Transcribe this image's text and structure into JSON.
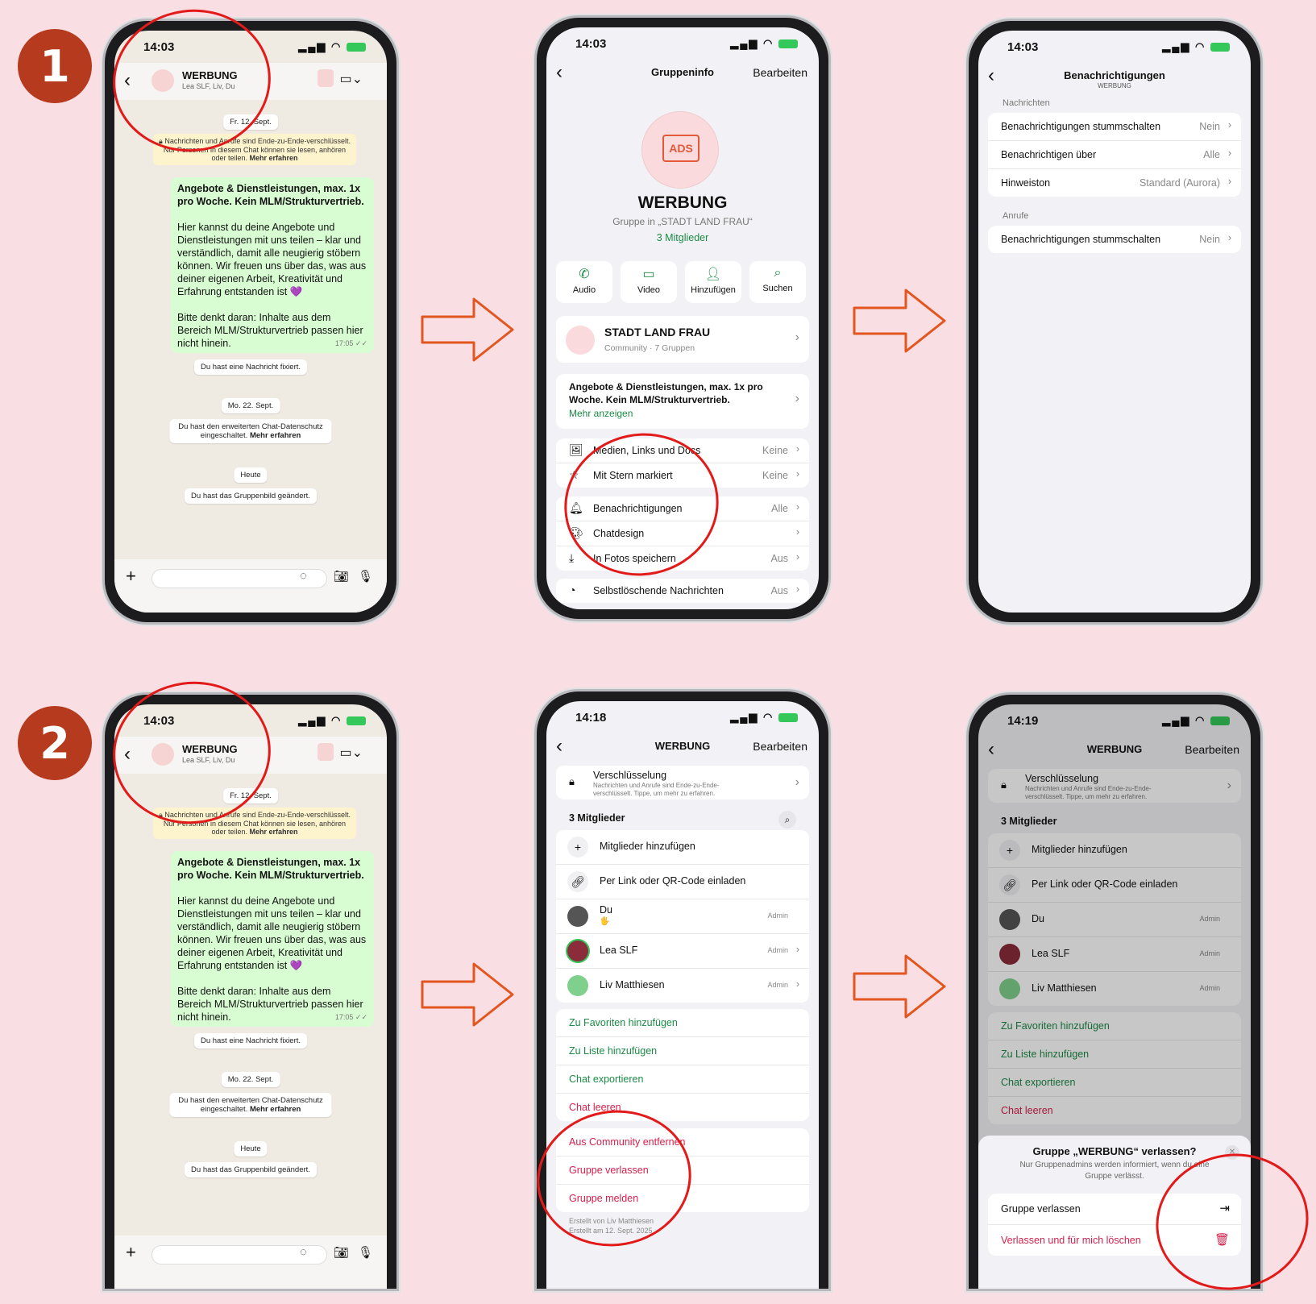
{
  "steps": [
    "1",
    "2"
  ],
  "status": {
    "time_chat": "14:03",
    "time_info2": "14:18",
    "time_info3": "14:19"
  },
  "chat": {
    "title": "WERBUNG",
    "subtitle": "Lea SLF, Liv, Du",
    "date1": "Fr. 12. Sept.",
    "encryption": "Nachrichten und Anrufe sind Ende-zu-Ende-verschlüsselt. Nur Personen in diesem Chat können sie lesen, anhören oder teilen.",
    "encryption_link": "Mehr erfahren",
    "bubble_title": "Angebote & Dienstleistungen, max. 1x pro Woche. Kein MLM/Strukturvertrieb.",
    "bubble_p1": "Hier kannst du deine Angebote und Dienstleistungen mit uns teilen – klar und verständlich, damit alle neugierig stöbern können. Wir freuen uns über das, was aus deiner eigenen Arbeit, Kreativität und Erfahrung entstanden ist 💜",
    "bubble_p2": "Bitte denkt daran: Inhalte aus dem Bereich MLM/Strukturvertrieb passen hier nicht hinein.",
    "bubble_time": "17:05 ✓✓",
    "pinned": "Du hast eine Nachricht fixiert.",
    "date2": "Mo. 22. Sept.",
    "privacy": "Du hast den erweiterten Chat-Datenschutz eingeschaltet.",
    "privacy_link": "Mehr erfahren",
    "date3": "Heute",
    "picture_changed": "Du hast das Gruppenbild geändert."
  },
  "groupinfo": {
    "nav_title": "Gruppeninfo",
    "edit": "Bearbeiten",
    "name": "WERBUNG",
    "group_in": "Gruppe in „STADT LAND FRAU“",
    "members": "3 Mitglieder",
    "avatar_text": "ADS",
    "actions": [
      "Audio",
      "Video",
      "Hinzufügen",
      "Suchen"
    ],
    "community_name": "STADT LAND FRAU",
    "community_sub": "Community · 7 Gruppen",
    "description": "Angebote & Dienstleistungen, max. 1x pro Woche. Kein MLM/Strukturvertrieb.",
    "more": "Mehr anzeigen",
    "rows1": [
      {
        "label": "Medien, Links und Docs",
        "value": "Keine"
      },
      {
        "label": "Mit Stern markiert",
        "value": "Keine"
      }
    ],
    "rows2": [
      {
        "label": "Benachrichtigungen",
        "value": "Alle"
      },
      {
        "label": "Chatdesign",
        "value": ""
      },
      {
        "label": "In Fotos speichern",
        "value": "Aus"
      }
    ],
    "row3": {
      "label": "Selbstlöschende Nachrichten",
      "value": "Aus"
    }
  },
  "notifications": {
    "title": "Benachrichtigungen",
    "subtitle": "WERBUNG",
    "section1": "Nachrichten",
    "rows1": [
      {
        "label": "Benachrichtigungen stummschalten",
        "value": "Nein"
      },
      {
        "label": "Benachrichtigen über",
        "value": "Alle"
      },
      {
        "label": "Hinweiston",
        "value": "Standard (Aurora)"
      }
    ],
    "section2": "Anrufe",
    "rows2": [
      {
        "label": "Benachrichtigungen stummschalten",
        "value": "Nein"
      }
    ]
  },
  "members_screen": {
    "title": "WERBUNG",
    "edit": "Bearbeiten",
    "encryption_title": "Verschlüsselung",
    "encryption_sub": "Nachrichten und Anrufe sind Ende-zu-Ende-verschlüsselt. Tippe, um mehr zu erfahren.",
    "members_heading": "3 Mitglieder",
    "add_members": "Mitglieder hinzufügen",
    "invite_link": "Per Link oder QR-Code einladen",
    "members": [
      {
        "name": "Du",
        "status": "🖐",
        "role": "Admin"
      },
      {
        "name": "Lea SLF",
        "role": "Admin"
      },
      {
        "name": "Liv Matthiesen",
        "role": "Admin"
      }
    ],
    "green_actions": [
      "Zu Favoriten hinzufügen",
      "Zu Liste hinzufügen",
      "Chat exportieren"
    ],
    "clear_chat": "Chat leeren",
    "red_actions": [
      "Aus Community entfernen",
      "Gruppe verlassen",
      "Gruppe melden"
    ],
    "created_by": "Erstellt von Liv Matthiesen",
    "created_on": "Erstellt am 12. Sept. 2025"
  },
  "leave_sheet": {
    "title": "Gruppe „WERBUNG“ verlassen?",
    "text": "Nur Gruppenadmins werden informiert, wenn du eine Gruppe verlässt.",
    "leave": "Gruppe verlassen",
    "leave_delete": "Verlassen und für mich löschen"
  },
  "colors": {
    "background": "#f9dfe4",
    "badge": "#b53a1e",
    "arrow": "#e2561f",
    "highlight": "#e21a1a",
    "whatsapp_green": "#1b8a45",
    "danger": "#d4204c"
  }
}
